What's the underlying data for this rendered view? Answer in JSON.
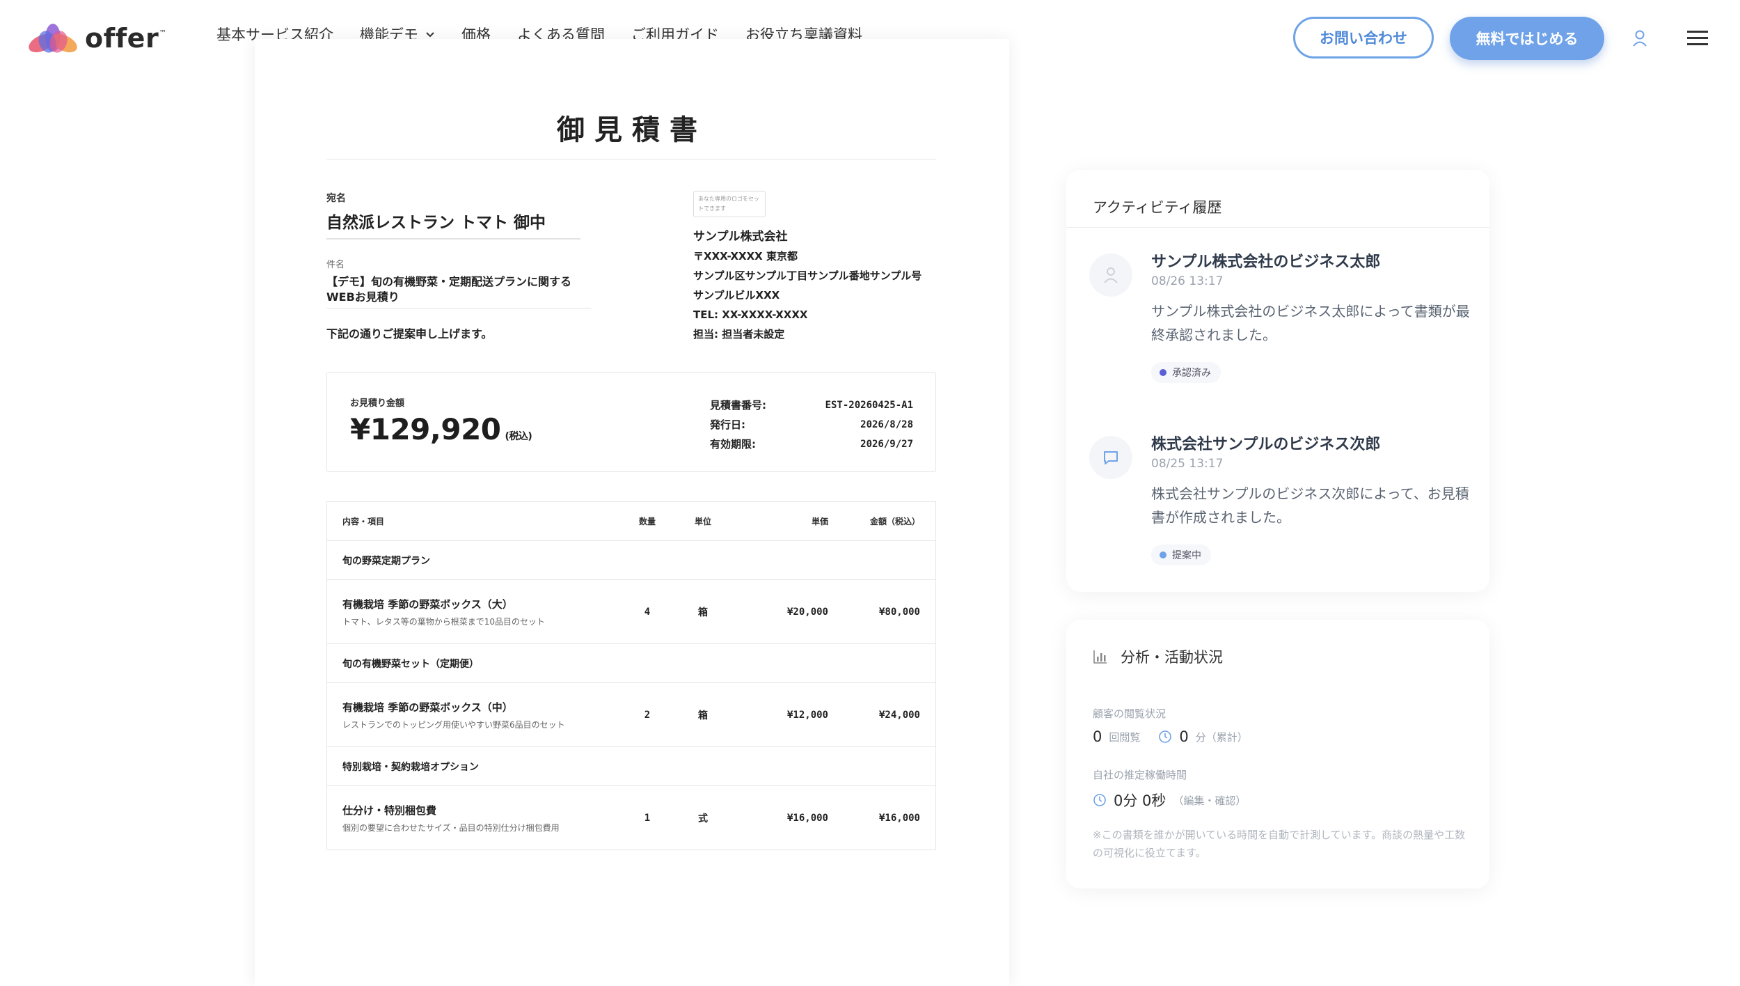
{
  "header": {
    "logo_text": "offer",
    "logo_tm": "™",
    "nav": [
      {
        "label": "基本サービス紹介"
      },
      {
        "label": "機能デモ"
      },
      {
        "label": "価格"
      },
      {
        "label": "よくある質問"
      },
      {
        "label": "ご利用ガイド"
      },
      {
        "label": "お役立ち稟議資料"
      }
    ],
    "contact_label": "お問い合わせ",
    "start_label": "無料ではじめる"
  },
  "doc": {
    "title": "御見積書",
    "addressee_label": "宛名",
    "addressee": "自然派レストラン トマト 御中",
    "subject_label": "件名",
    "subject_line1": "【デモ】旬の有機野菜・定期配送プランに関する",
    "subject_line2": "WEBお見積り",
    "intro": "下記の通りご提案申し上げます。",
    "logo_placeholder": "あなた専用のロゴをセットできます",
    "company": {
      "name": "サンプル株式会社",
      "postal": "〒XXX-XXXX 東京都",
      "address": "サンプル区サンプル丁目サンプル番地サンプル号",
      "building": "サンプルビルXXX",
      "tel": "TEL: XX-XXXX-XXXX",
      "contact": "担当: 担当者未設定"
    },
    "summary": {
      "label": "お見積り金額",
      "amount": "¥129,920",
      "tax_note": "(税込)",
      "number_label": "見積書番号:",
      "number": "EST-20260425-A1",
      "issued_label": "発行日:",
      "issued": "2026/8/28",
      "valid_label": "有効期限:",
      "valid": "2026/9/27"
    },
    "table": {
      "headers": {
        "desc": "内容・項目",
        "qty": "数量",
        "unit": "単位",
        "price": "単価",
        "amount": "金額（税込）"
      },
      "sections": [
        {
          "title": "旬の野菜定期プラン",
          "item": {
            "name": "有機栽培 季節の野菜ボックス（大）",
            "desc": "トマト、レタス等の葉物から根菜まで10品目のセット",
            "qty": "4",
            "unit": "箱",
            "price": "¥20,000",
            "amount": "¥80,000"
          }
        },
        {
          "title": "旬の有機野菜セット（定期便）",
          "item": {
            "name": "有機栽培 季節の野菜ボックス（中）",
            "desc": "レストランでのトッピング用使いやすい野菜6品目のセット",
            "qty": "2",
            "unit": "箱",
            "price": "¥12,000",
            "amount": "¥24,000"
          }
        },
        {
          "title": "特別栽培・契約栽培オプション",
          "item": {
            "name": "仕分け・特別梱包費",
            "desc": "個別の要望に合わせたサイズ・品目の特別仕分け梱包費用",
            "qty": "1",
            "unit": "式",
            "price": "¥16,000",
            "amount": "¥16,000"
          }
        }
      ]
    }
  },
  "activity": {
    "title": "アクティビティ履歴",
    "entries": [
      {
        "name": "サンプル株式会社のビジネス太郎",
        "time": "08/26 13:17",
        "body": "サンプル株式会社のビジネス太郎によって書類が最終承認されました。",
        "badge": "承認済み",
        "badge_color": "#5b5fd6",
        "icon": "user-icon"
      },
      {
        "name": "株式会社サンプルのビジネス次郎",
        "time": "08/25 13:17",
        "body": "株式会社サンプルのビジネス次郎によって、お見積書が作成されました。",
        "badge": "提案中",
        "badge_color": "#6fa2e8",
        "icon": "comment-icon"
      }
    ]
  },
  "analytics": {
    "title": "分析・活動状況",
    "viewing_label": "顧客の閲覧状況",
    "views": "0",
    "views_unit": "回閲覧",
    "minutes": "0",
    "minutes_unit": "分（累計）",
    "worktime_label": "自社の推定稼働時間",
    "worktime": "0分 0秒",
    "worktime_unit": "（編集・確認）",
    "note": "※この書類を誰かが開いている時間を自動で計測しています。商談の熱量や工数の可視化に役立てます。"
  },
  "colors": {
    "accent": "#6fa2e8",
    "approved": "#5b5fd6"
  }
}
